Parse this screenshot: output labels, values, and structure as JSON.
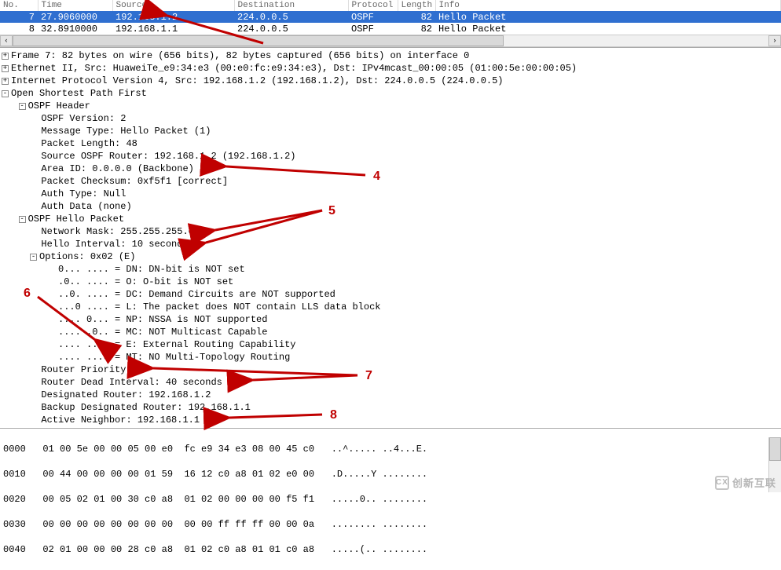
{
  "columns": {
    "no": "No.",
    "time": "Time",
    "source": "Source",
    "destination": "Destination",
    "protocol": "Protocol",
    "length": "Length",
    "info": "Info"
  },
  "packets": [
    {
      "no": "7",
      "time": "27.9060000",
      "source": "192.168.1.2",
      "destination": "224.0.0.5",
      "protocol": "OSPF",
      "length": "82",
      "info": "Hello Packet",
      "selected": true
    },
    {
      "no": "8",
      "time": "32.8910000",
      "source": "192.168.1.1",
      "destination": "224.0.0.5",
      "protocol": "OSPF",
      "length": "82",
      "info": "Hello Packet",
      "selected": false
    }
  ],
  "details": {
    "frame": "Frame 7: 82 bytes on wire (656 bits), 82 bytes captured (656 bits) on interface 0",
    "eth": "Ethernet II, Src: HuaweiTe_e9:34:e3 (00:e0:fc:e9:34:e3), Dst: IPv4mcast_00:00:05 (01:00:5e:00:00:05)",
    "ip": "Internet Protocol Version 4, Src: 192.168.1.2 (192.168.1.2), Dst: 224.0.0.5 (224.0.0.5)",
    "ospf": "Open Shortest Path First",
    "hdr": "OSPF Header",
    "ver": "OSPF Version: 2",
    "msgtype": "Message Type: Hello Packet (1)",
    "pktlen": "Packet Length: 48",
    "srcrouter": "Source OSPF Router: 192.168.1.2 (192.168.1.2)",
    "area": "Area ID: 0.0.0.0 (Backbone)",
    "cksum": "Packet Checksum: 0xf5f1 [correct]",
    "authtype": "Auth Type: Null",
    "authdata": "Auth Data (none)",
    "hello": "OSPF Hello Packet",
    "mask": "Network Mask: 255.255.255.0",
    "hint": "Hello Interval: 10 seconds",
    "opts": "Options: 0x02 (E)",
    "o_dn": "0... .... = DN: DN-bit is NOT set",
    "o_o": ".0.. .... = O: O-bit is NOT set",
    "o_dc": "..0. .... = DC: Demand Circuits are NOT supported",
    "o_l": "...0 .... = L: The packet does NOT contain LLS data block",
    "o_np": ".... 0... = NP: NSSA is NOT supported",
    "o_mc": ".... .0.. = MC: NOT Multicast Capable",
    "o_e": ".... ..1. = E: External Routing Capability",
    "o_mt": ".... ...0 = MT: NO Multi-Topology Routing",
    "prio": "Router Priority: 1",
    "dead": "Router Dead Interval: 40 seconds",
    "dr": "Designated Router: 192.168.1.2",
    "bdr": "Backup Designated Router: 192.168.1.1",
    "neigh": "Active Neighbor: 192.168.1.1"
  },
  "hex": {
    "l0_off": "0000",
    "l0_hex": "01 00 5e 00 00 05 00 e0  fc e9 34 e3 08 00 45 c0",
    "l0_asc": "..^..... ..4...E.",
    "l1_off": "0010",
    "l1_hex": "00 44 00 00 00 00 01 59  16 12 c0 a8 01 02 e0 00",
    "l1_asc": ".D.....Y ........",
    "l2_off": "0020",
    "l2_hex": "00 05 02 01 00 30 c0 a8  01 02 00 00 00 00 f5 f1",
    "l2_asc": ".....0.. ........",
    "l3_off": "0030",
    "l3_hex": "00 00 00 00 00 00 00 00  00 00 ff ff ff 00 00 0a",
    "l3_asc": "........ ........",
    "l4_off": "0040",
    "l4_hex": "02 01 00 00 00 28 c0 a8  01 02 c0 a8 01 01 c0 a8",
    "l4_asc": ".....(.. ........"
  },
  "annotations": {
    "a4": "4",
    "a5": "5",
    "a6": "6",
    "a7": "7",
    "a8": "8"
  },
  "watermark": "创新互联"
}
